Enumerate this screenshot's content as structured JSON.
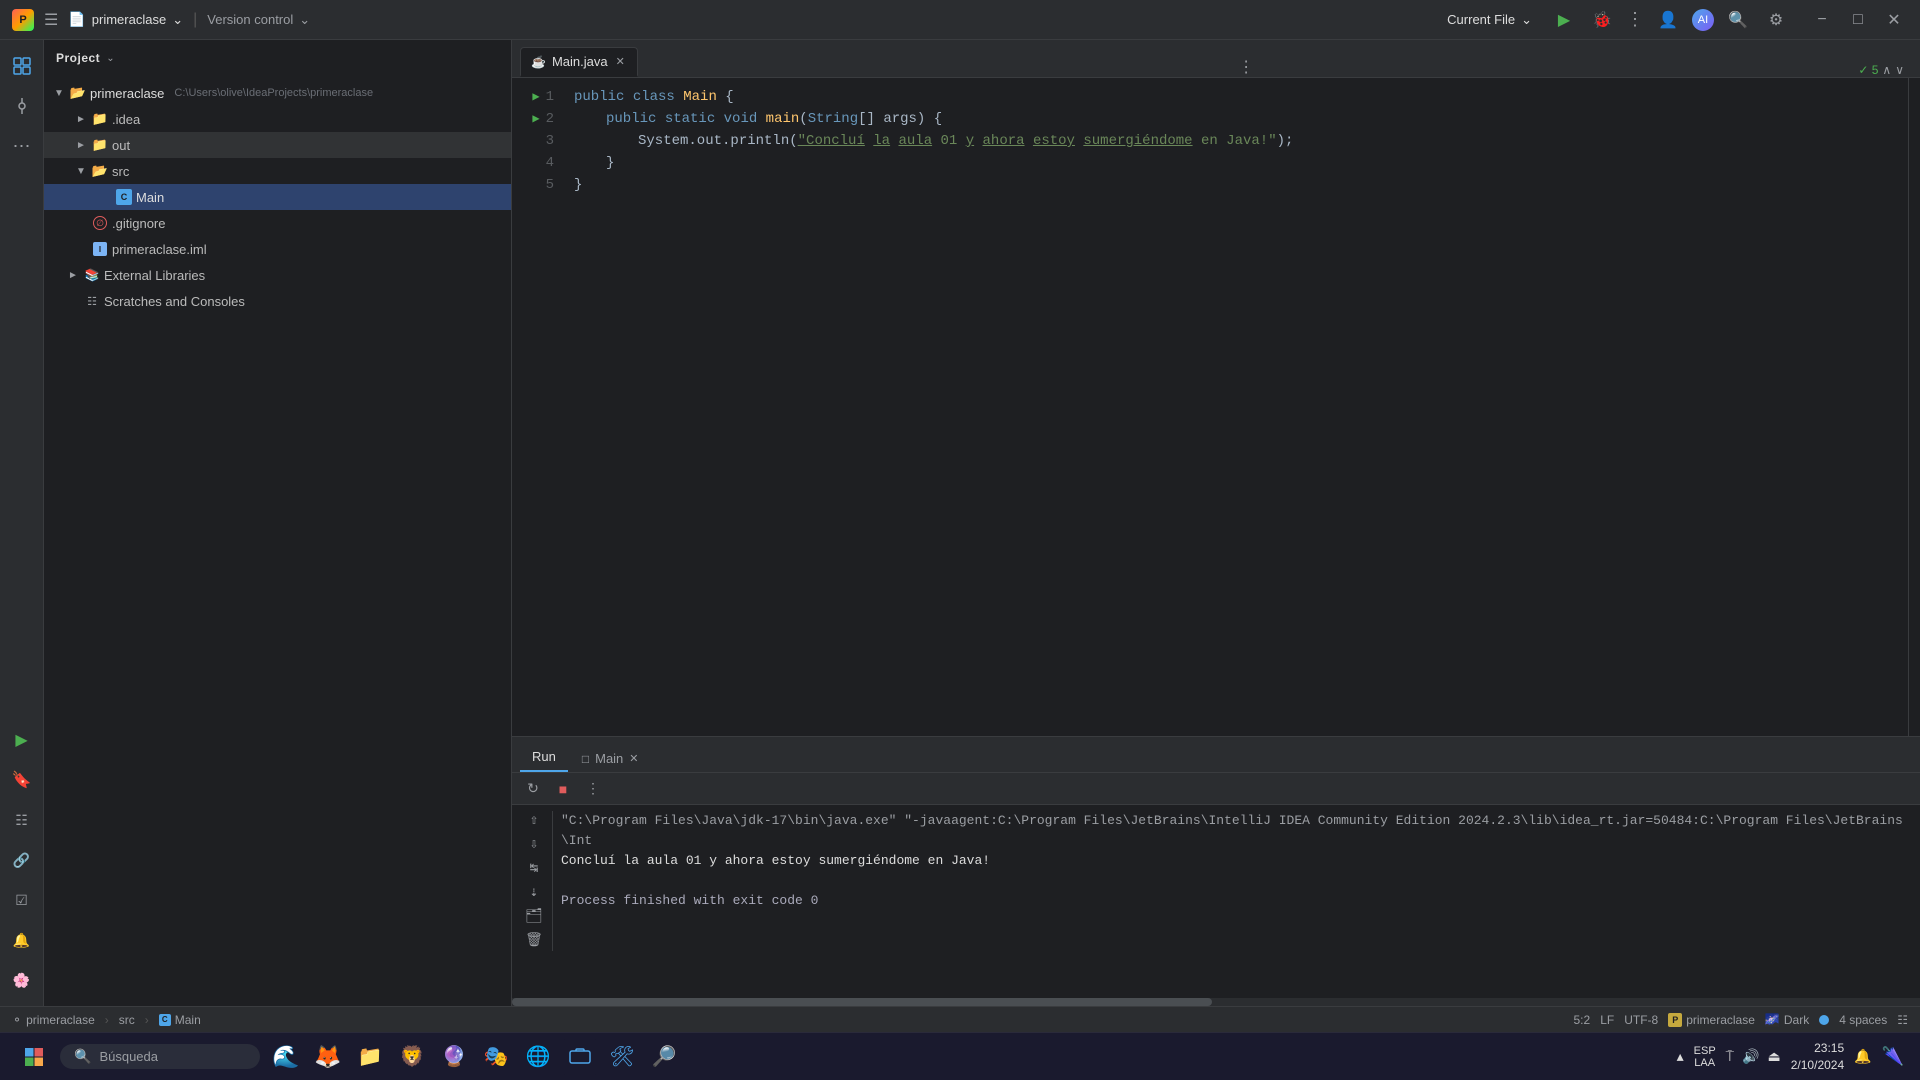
{
  "titlebar": {
    "project_name": "primeraclase",
    "vcs_label": "Version control",
    "current_file_label": "Current File",
    "run_tooltip": "Run",
    "debug_tooltip": "Debug"
  },
  "sidebar": {
    "header": "Project",
    "tree": {
      "root": {
        "name": "primeraclase",
        "path": "C:\\Users\\olive\\IdeaProjects\\primeraclase",
        "children": [
          {
            "id": "idea",
            "name": ".idea",
            "type": "folder"
          },
          {
            "id": "out",
            "name": "out",
            "type": "folder",
            "highlighted": true
          },
          {
            "id": "src",
            "name": "src",
            "type": "folder",
            "expanded": true,
            "children": [
              {
                "id": "main",
                "name": "Main",
                "type": "java",
                "active": true
              }
            ]
          },
          {
            "id": "gitignore",
            "name": ".gitignore",
            "type": "gitignore"
          },
          {
            "id": "primlabel",
            "name": "primeraclase.iml",
            "type": "iml"
          },
          {
            "id": "extlibs",
            "name": "External Libraries",
            "type": "extlib"
          },
          {
            "id": "scratches",
            "name": "Scratches and Consoles",
            "type": "scratch"
          }
        ]
      }
    }
  },
  "editor": {
    "tab_label": "Main.java",
    "tab_icon": "☕",
    "check_count": "✓5",
    "lines": [
      {
        "num": 1,
        "has_run": true,
        "code": "public class Main {"
      },
      {
        "num": 2,
        "has_run": true,
        "code": "    public static void main(String[] args) {"
      },
      {
        "num": 3,
        "has_run": false,
        "code": "        System.out.println(\"Concluí la aula 01 y ahora estoy sumergiéndome en Java!\");"
      },
      {
        "num": 4,
        "has_run": false,
        "code": "    }"
      },
      {
        "num": 5,
        "has_run": false,
        "code": "}"
      }
    ]
  },
  "bottom_panel": {
    "run_tab": "Run",
    "main_tab": "Main",
    "console": {
      "cmd_line": "\"C:\\Program Files\\Java\\jdk-17\\bin\\java.exe\" \"-javaagent:C:\\Program Files\\JetBrains\\IntelliJ IDEA Community Edition 2024.2.3\\lib\\idea_rt.jar=50484:C:\\Program Files\\JetBrains\\Int",
      "output_line": "Concluí la aula 01 y ahora estoy sumergiéndome en Java!",
      "exit_line": "Process finished with exit code 0"
    }
  },
  "status_bar": {
    "project_name": "primeraclase",
    "src_path": "src",
    "main_class": "Main",
    "cursor_pos": "5:2",
    "line_ending": "LF",
    "encoding": "UTF-8",
    "profile": "primeraclase",
    "theme": "Dark",
    "indent": "4 spaces"
  },
  "taskbar": {
    "search_placeholder": "Búsqueda",
    "time": "23:15",
    "date": "2/10/2024",
    "lang": "ESP\nLAA"
  }
}
